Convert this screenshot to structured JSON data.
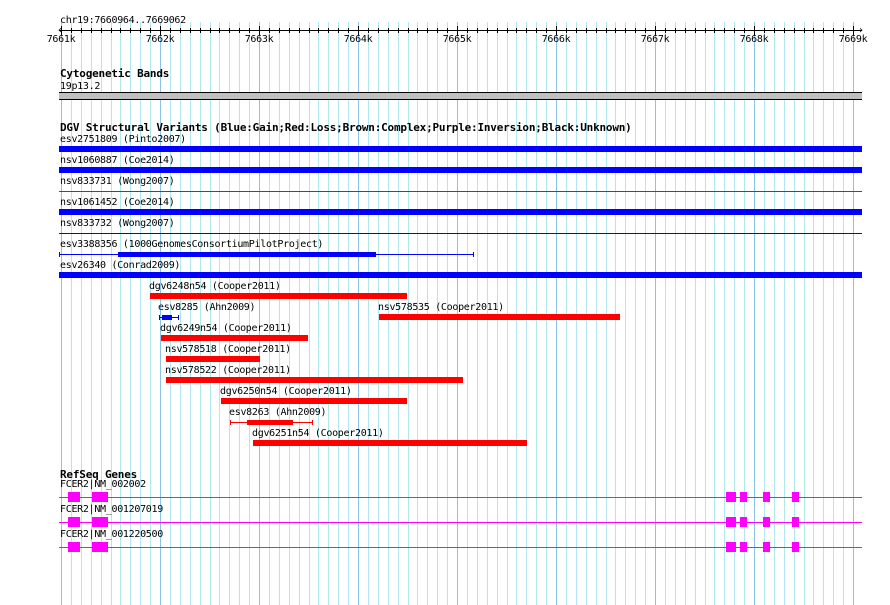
{
  "ruler": {
    "locus": "chr19:7660964..7669062",
    "ticks_kb": [
      "7661k",
      "7662k",
      "7663k",
      "7664k",
      "7665k",
      "7666k",
      "7667k",
      "7668k",
      "7669k"
    ],
    "range_kb": [
      7660.964,
      7669.062
    ]
  },
  "cyto": {
    "title": "Cytogenetic Bands",
    "band": "19p13.2",
    "color": "#c0c0c0"
  },
  "dgv": {
    "title": "DGV Structural Variants (Blue:Gain;Red:Loss;Brown:Complex;Purple:Inversion;Black:Unknown)",
    "colors": {
      "gain": "#0000ff",
      "loss": "#ff0000"
    },
    "features": [
      {
        "label": "esv2751809 (Pinto2007)",
        "type": "gain",
        "style": "thick",
        "start": 7660.96,
        "end": 7669.1
      },
      {
        "label": "nsv1060887 (Coe2014)",
        "type": "gain",
        "style": "thick",
        "start": 7660.96,
        "end": 7669.1
      },
      {
        "label": "nsv833731 (Wong2007)",
        "type": "loss",
        "style": "thin",
        "start": 7660.96,
        "end": 7669.1
      },
      {
        "label": "nsv1061452 (Coe2014)",
        "type": "gain",
        "style": "thick",
        "start": 7660.96,
        "end": 7669.1
      },
      {
        "label": "nsv833732 (Wong2007)",
        "type": "gain",
        "style": "thin",
        "start": 7660.96,
        "end": 7669.1
      },
      {
        "label": "esv3388356 (1000GenomesConsortiumPilotProject)",
        "type": "gain",
        "style": "range",
        "start": 7660.96,
        "end": 7665.17,
        "core_start": 7661.58,
        "core_end": 7664.18
      },
      {
        "label": "esv26340 (Conrad2009)",
        "type": "gain",
        "style": "thick",
        "start": 7660.96,
        "end": 7669.1
      },
      {
        "label": "dgv6248n54 (Cooper2011)",
        "type": "loss",
        "style": "thick",
        "start": 7661.9,
        "end": 7664.49
      },
      {
        "label": "esv8285 (Ahn2009)",
        "type": "gain",
        "style": "range",
        "start": 7661.99,
        "end": 7662.19,
        "core_start": 7662.02,
        "core_end": 7662.12
      },
      {
        "label": "nsv578535 (Cooper2011)",
        "type": "loss",
        "style": "thick",
        "start": 7664.21,
        "end": 7666.65
      },
      {
        "label": "dgv6249n54 (Cooper2011)",
        "type": "loss",
        "style": "thick",
        "start": 7662.01,
        "end": 7663.49
      },
      {
        "label": "nsv578518 (Cooper2011)",
        "type": "loss",
        "style": "thick",
        "start": 7662.06,
        "end": 7663.01
      },
      {
        "label": "nsv578522 (Cooper2011)",
        "type": "loss",
        "style": "thick",
        "start": 7662.06,
        "end": 7665.06
      },
      {
        "label": "dgv6250n54 (Cooper2011)",
        "type": "loss",
        "style": "thick",
        "start": 7662.62,
        "end": 7664.49
      },
      {
        "label": "esv8263 (Ahn2009)",
        "type": "loss",
        "style": "range",
        "start": 7662.71,
        "end": 7663.55,
        "core_start": 7662.88,
        "core_end": 7663.34
      },
      {
        "label": "dgv6251n54 (Cooper2011)",
        "type": "loss",
        "style": "thick",
        "start": 7662.94,
        "end": 7665.71
      }
    ]
  },
  "refseq": {
    "title": "RefSeq Genes",
    "color": "#ff00ff",
    "genes": [
      {
        "label": "FCER2|NM_002002"
      },
      {
        "label": "FCER2|NM_001207019"
      },
      {
        "label": "FCER2|NM_001220500"
      }
    ],
    "exons_kb": [
      [
        7661.07,
        7661.19
      ],
      [
        7661.31,
        7661.47
      ],
      [
        7667.72,
        7667.82
      ],
      [
        7667.86,
        7667.93
      ],
      [
        7668.09,
        7668.16
      ],
      [
        7668.38,
        7668.45
      ]
    ]
  }
}
